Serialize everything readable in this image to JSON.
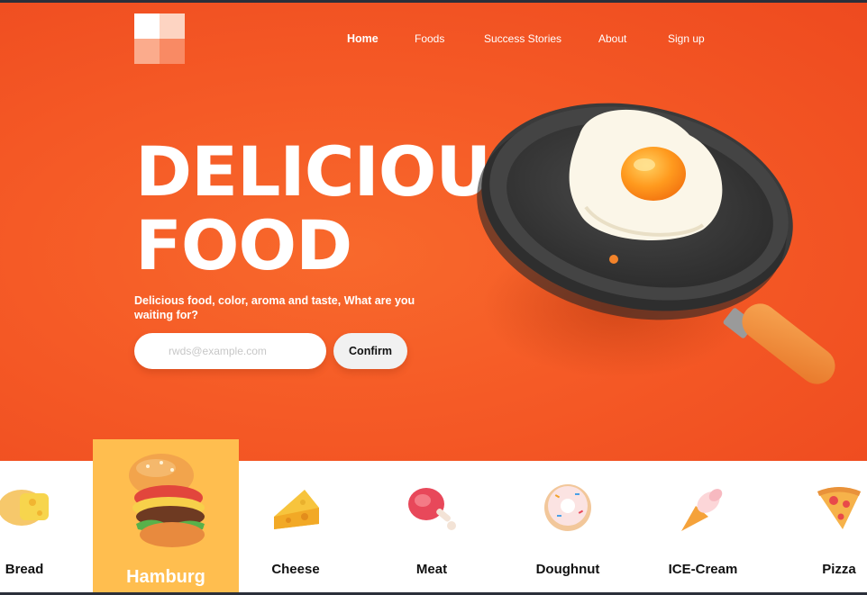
{
  "nav": {
    "items": [
      "Home",
      "Foods",
      "Success Stories",
      "About",
      "Sign up"
    ],
    "active": "Home"
  },
  "hero": {
    "headline_line1": "DELICIOUS",
    "headline_line2": "FOOD",
    "subtitle": "Delicious food, color, aroma and taste, What are you waiting for?",
    "email_placeholder": "rwds@example.com",
    "confirm_label": "Confirm"
  },
  "categories": {
    "items": [
      "Bread",
      "Hamburg",
      "Cheese",
      "Meat",
      "Doughnut",
      "ICE-Cream",
      "Pizza"
    ],
    "active": "Hamburg"
  },
  "colors": {
    "hero_orange": "#f55a26",
    "active_tile": "#ffbe4f"
  }
}
